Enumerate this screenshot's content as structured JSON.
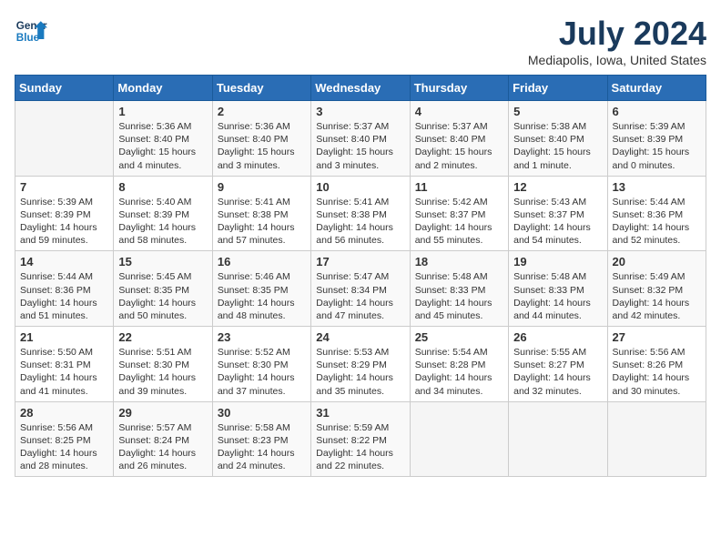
{
  "header": {
    "logo_line1": "General",
    "logo_line2": "Blue",
    "month_title": "July 2024",
    "location": "Mediapolis, Iowa, United States"
  },
  "days_of_week": [
    "Sunday",
    "Monday",
    "Tuesday",
    "Wednesday",
    "Thursday",
    "Friday",
    "Saturday"
  ],
  "weeks": [
    [
      {
        "day": "",
        "info": ""
      },
      {
        "day": "1",
        "info": "Sunrise: 5:36 AM\nSunset: 8:40 PM\nDaylight: 15 hours\nand 4 minutes."
      },
      {
        "day": "2",
        "info": "Sunrise: 5:36 AM\nSunset: 8:40 PM\nDaylight: 15 hours\nand 3 minutes."
      },
      {
        "day": "3",
        "info": "Sunrise: 5:37 AM\nSunset: 8:40 PM\nDaylight: 15 hours\nand 3 minutes."
      },
      {
        "day": "4",
        "info": "Sunrise: 5:37 AM\nSunset: 8:40 PM\nDaylight: 15 hours\nand 2 minutes."
      },
      {
        "day": "5",
        "info": "Sunrise: 5:38 AM\nSunset: 8:40 PM\nDaylight: 15 hours\nand 1 minute."
      },
      {
        "day": "6",
        "info": "Sunrise: 5:39 AM\nSunset: 8:39 PM\nDaylight: 15 hours\nand 0 minutes."
      }
    ],
    [
      {
        "day": "7",
        "info": "Sunrise: 5:39 AM\nSunset: 8:39 PM\nDaylight: 14 hours\nand 59 minutes."
      },
      {
        "day": "8",
        "info": "Sunrise: 5:40 AM\nSunset: 8:39 PM\nDaylight: 14 hours\nand 58 minutes."
      },
      {
        "day": "9",
        "info": "Sunrise: 5:41 AM\nSunset: 8:38 PM\nDaylight: 14 hours\nand 57 minutes."
      },
      {
        "day": "10",
        "info": "Sunrise: 5:41 AM\nSunset: 8:38 PM\nDaylight: 14 hours\nand 56 minutes."
      },
      {
        "day": "11",
        "info": "Sunrise: 5:42 AM\nSunset: 8:37 PM\nDaylight: 14 hours\nand 55 minutes."
      },
      {
        "day": "12",
        "info": "Sunrise: 5:43 AM\nSunset: 8:37 PM\nDaylight: 14 hours\nand 54 minutes."
      },
      {
        "day": "13",
        "info": "Sunrise: 5:44 AM\nSunset: 8:36 PM\nDaylight: 14 hours\nand 52 minutes."
      }
    ],
    [
      {
        "day": "14",
        "info": "Sunrise: 5:44 AM\nSunset: 8:36 PM\nDaylight: 14 hours\nand 51 minutes."
      },
      {
        "day": "15",
        "info": "Sunrise: 5:45 AM\nSunset: 8:35 PM\nDaylight: 14 hours\nand 50 minutes."
      },
      {
        "day": "16",
        "info": "Sunrise: 5:46 AM\nSunset: 8:35 PM\nDaylight: 14 hours\nand 48 minutes."
      },
      {
        "day": "17",
        "info": "Sunrise: 5:47 AM\nSunset: 8:34 PM\nDaylight: 14 hours\nand 47 minutes."
      },
      {
        "day": "18",
        "info": "Sunrise: 5:48 AM\nSunset: 8:33 PM\nDaylight: 14 hours\nand 45 minutes."
      },
      {
        "day": "19",
        "info": "Sunrise: 5:48 AM\nSunset: 8:33 PM\nDaylight: 14 hours\nand 44 minutes."
      },
      {
        "day": "20",
        "info": "Sunrise: 5:49 AM\nSunset: 8:32 PM\nDaylight: 14 hours\nand 42 minutes."
      }
    ],
    [
      {
        "day": "21",
        "info": "Sunrise: 5:50 AM\nSunset: 8:31 PM\nDaylight: 14 hours\nand 41 minutes."
      },
      {
        "day": "22",
        "info": "Sunrise: 5:51 AM\nSunset: 8:30 PM\nDaylight: 14 hours\nand 39 minutes."
      },
      {
        "day": "23",
        "info": "Sunrise: 5:52 AM\nSunset: 8:30 PM\nDaylight: 14 hours\nand 37 minutes."
      },
      {
        "day": "24",
        "info": "Sunrise: 5:53 AM\nSunset: 8:29 PM\nDaylight: 14 hours\nand 35 minutes."
      },
      {
        "day": "25",
        "info": "Sunrise: 5:54 AM\nSunset: 8:28 PM\nDaylight: 14 hours\nand 34 minutes."
      },
      {
        "day": "26",
        "info": "Sunrise: 5:55 AM\nSunset: 8:27 PM\nDaylight: 14 hours\nand 32 minutes."
      },
      {
        "day": "27",
        "info": "Sunrise: 5:56 AM\nSunset: 8:26 PM\nDaylight: 14 hours\nand 30 minutes."
      }
    ],
    [
      {
        "day": "28",
        "info": "Sunrise: 5:56 AM\nSunset: 8:25 PM\nDaylight: 14 hours\nand 28 minutes."
      },
      {
        "day": "29",
        "info": "Sunrise: 5:57 AM\nSunset: 8:24 PM\nDaylight: 14 hours\nand 26 minutes."
      },
      {
        "day": "30",
        "info": "Sunrise: 5:58 AM\nSunset: 8:23 PM\nDaylight: 14 hours\nand 24 minutes."
      },
      {
        "day": "31",
        "info": "Sunrise: 5:59 AM\nSunset: 8:22 PM\nDaylight: 14 hours\nand 22 minutes."
      },
      {
        "day": "",
        "info": ""
      },
      {
        "day": "",
        "info": ""
      },
      {
        "day": "",
        "info": ""
      }
    ]
  ]
}
